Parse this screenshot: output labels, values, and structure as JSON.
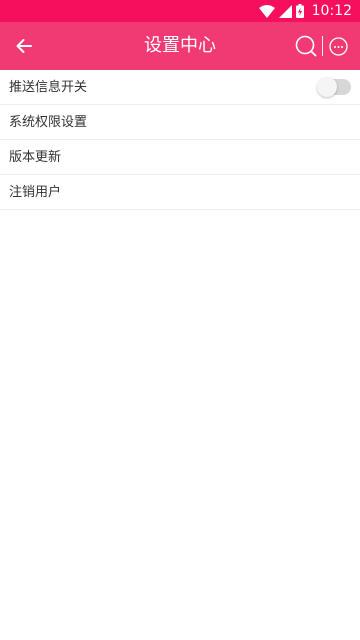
{
  "status_bar": {
    "time": "10:12",
    "icons": [
      "wifi-icon",
      "cellular-signal-icon",
      "battery-charging-icon"
    ]
  },
  "app_bar": {
    "title": "设置中心",
    "back_icon": "arrow-left-icon",
    "search_icon": "search-icon",
    "more_icon": "more-dots-circle-icon"
  },
  "settings": {
    "items": [
      {
        "label": "推送信息开关",
        "has_toggle": true,
        "toggle_on": false
      },
      {
        "label": "系统权限设置"
      },
      {
        "label": "版本更新"
      },
      {
        "label": "注销用户"
      }
    ]
  },
  "colors": {
    "status_bar": "#f50f5c",
    "app_bar": "#f13a74",
    "text": "#333333",
    "divider": "#eeeeee",
    "toggle_track_off": "#d7d7d7"
  }
}
